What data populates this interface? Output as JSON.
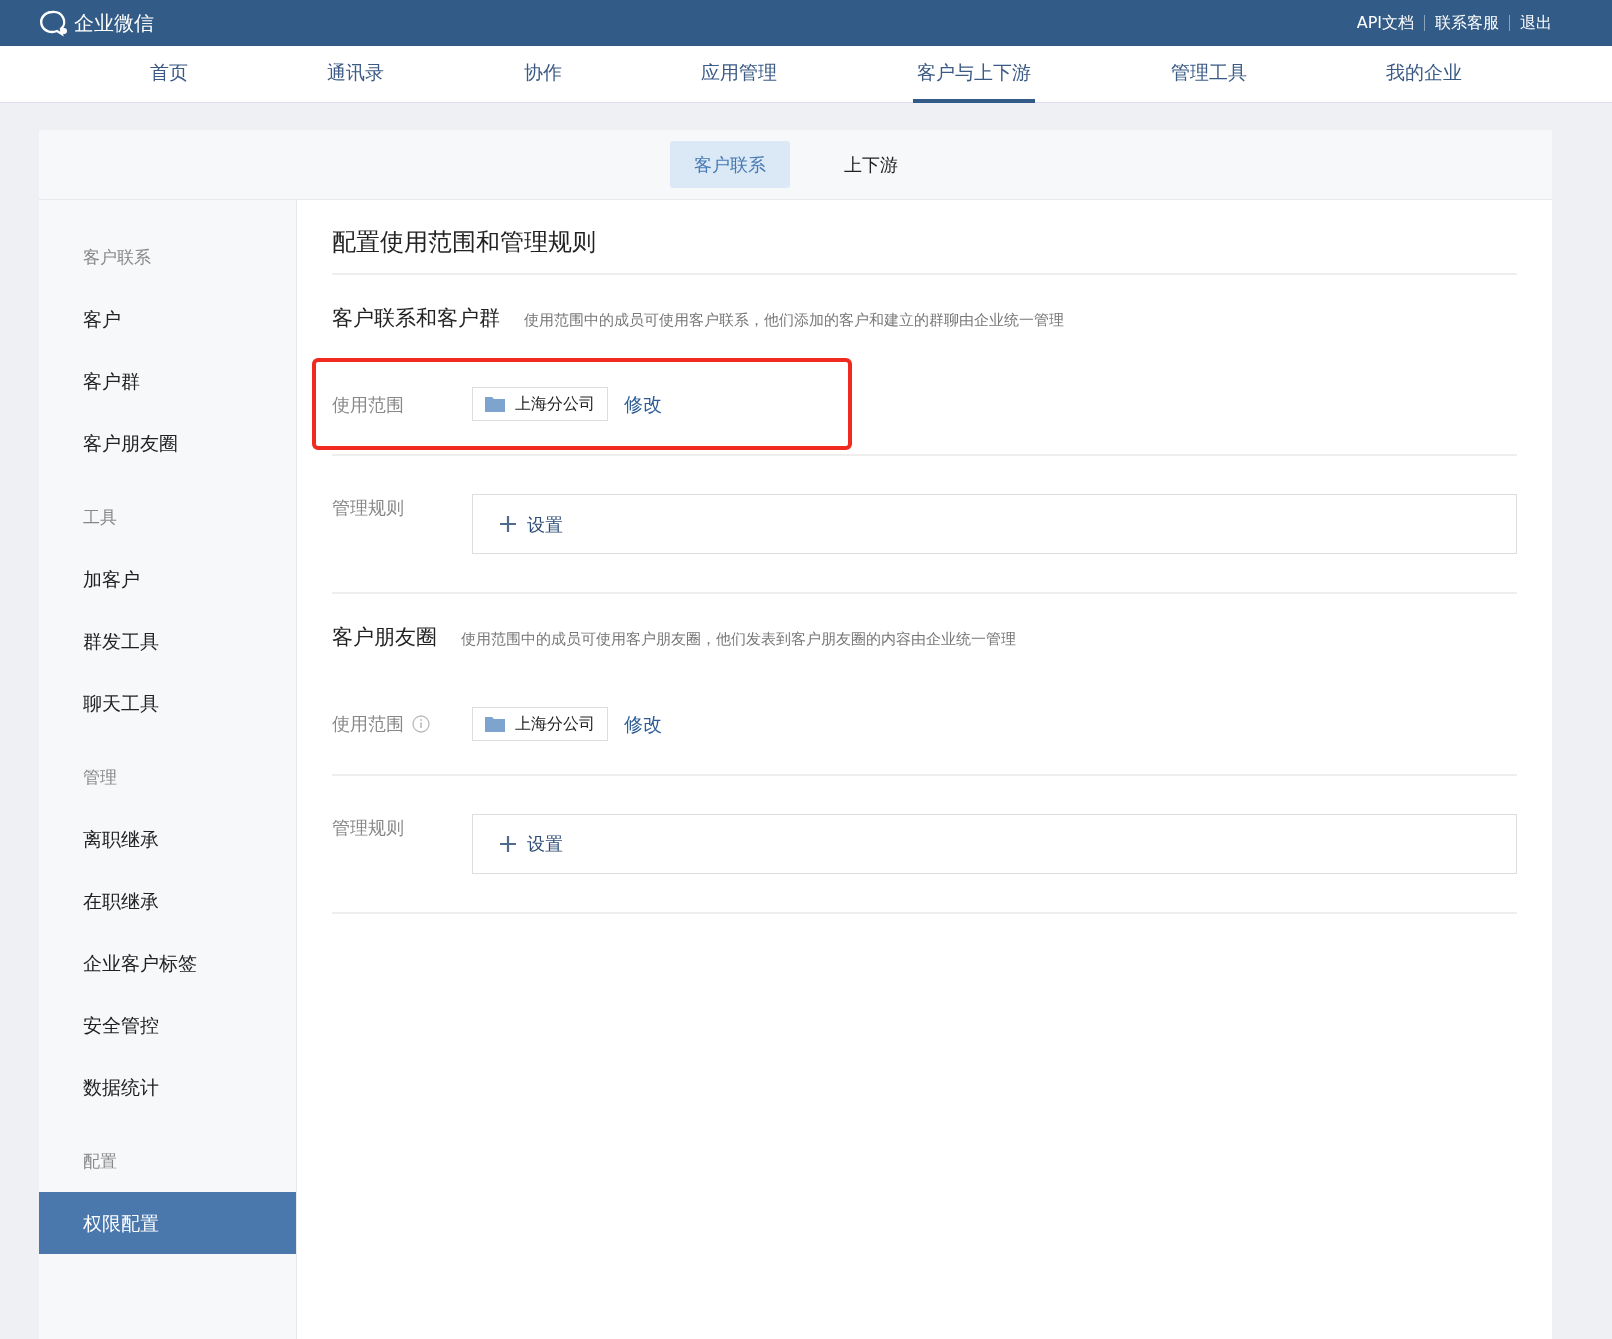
{
  "topbar": {
    "logo": "企业微信",
    "links": [
      "API文档",
      "联系客服",
      "退出"
    ]
  },
  "nav": [
    {
      "label": "首页",
      "selected": false
    },
    {
      "label": "通讯录",
      "selected": false
    },
    {
      "label": "协作",
      "selected": false
    },
    {
      "label": "应用管理",
      "selected": false
    },
    {
      "label": "客户与上下游",
      "selected": true
    },
    {
      "label": "管理工具",
      "selected": false
    },
    {
      "label": "我的企业",
      "selected": false
    }
  ],
  "subtabs": [
    {
      "label": "客户联系",
      "selected": true
    },
    {
      "label": "上下游",
      "selected": false
    }
  ],
  "sidebar": [
    {
      "heading": "客户联系",
      "items": [
        {
          "label": "客户",
          "selected": false
        },
        {
          "label": "客户群",
          "selected": false
        },
        {
          "label": "客户朋友圈",
          "selected": false
        }
      ]
    },
    {
      "heading": "工具",
      "items": [
        {
          "label": "加客户",
          "selected": false
        },
        {
          "label": "群发工具",
          "selected": false
        },
        {
          "label": "聊天工具",
          "selected": false
        }
      ]
    },
    {
      "heading": "管理",
      "items": [
        {
          "label": "离职继承",
          "selected": false
        },
        {
          "label": "在职继承",
          "selected": false
        },
        {
          "label": "企业客户标签",
          "selected": false
        },
        {
          "label": "安全管控",
          "selected": false
        },
        {
          "label": "数据统计",
          "selected": false
        }
      ]
    },
    {
      "heading": "配置",
      "items": [
        {
          "label": "权限配置",
          "selected": true
        }
      ]
    }
  ],
  "page_title": "配置使用范围和管理规则",
  "sections": [
    {
      "title": "客户联系和客户群",
      "description": "使用范围中的成员可使用客户联系，他们添加的客户和建立的群聊由企业统一管理",
      "scope": {
        "label": "使用范围",
        "info": false,
        "tag": "上海分公司",
        "link": "修改",
        "highlighted": true
      },
      "rules": {
        "label": "管理规则",
        "button": "设置"
      }
    },
    {
      "title": "客户朋友圈",
      "description": "使用范围中的成员可使用客户朋友圈，他们发表到客户朋友圈的内容由企业统一管理",
      "scope": {
        "label": "使用范围",
        "info": true,
        "tag": "上海分公司",
        "link": "修改",
        "highlighted": false
      },
      "rules": {
        "label": "管理规则",
        "button": "设置"
      }
    }
  ]
}
